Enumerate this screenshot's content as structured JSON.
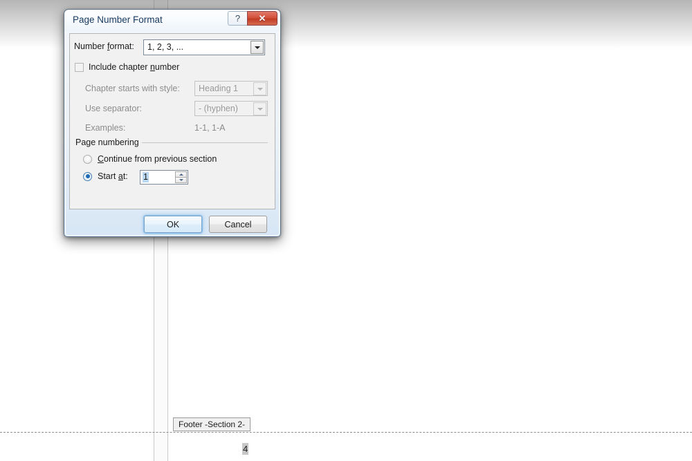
{
  "document": {
    "footer_tab_label": "Footer -Section 2-",
    "page_number_text": "4"
  },
  "dialog": {
    "title": "Page Number Format",
    "help_button_label": "?",
    "close_button_label": "✕",
    "number_format": {
      "label_pre": "Number ",
      "label_key": "f",
      "label_post": "ormat:",
      "value": "1, 2, 3, ..."
    },
    "include_chapter": {
      "label_pre": "Include chapter ",
      "label_key": "n",
      "label_post": "umber",
      "checked": false
    },
    "chapter_style": {
      "label": "Chapter starts with style:",
      "value": "Heading 1"
    },
    "separator": {
      "label": "Use separator:",
      "value": "-   (hyphen)"
    },
    "examples": {
      "label": "Examples:",
      "value": "1-1, 1-A"
    },
    "page_numbering": {
      "group_title": "Page numbering",
      "continue_option": {
        "label_pre": "",
        "label_key": "C",
        "label_post": "ontinue from previous section",
        "selected": false
      },
      "start_at_option": {
        "label_pre": "Start ",
        "label_key": "a",
        "label_post": "t:",
        "selected": true,
        "value": "1"
      }
    },
    "ok_label": "OK",
    "cancel_label": "Cancel"
  },
  "colors": {
    "accent": "#1f6bb5",
    "close_red": "#c23c24",
    "selection": "#bcd7f0"
  }
}
